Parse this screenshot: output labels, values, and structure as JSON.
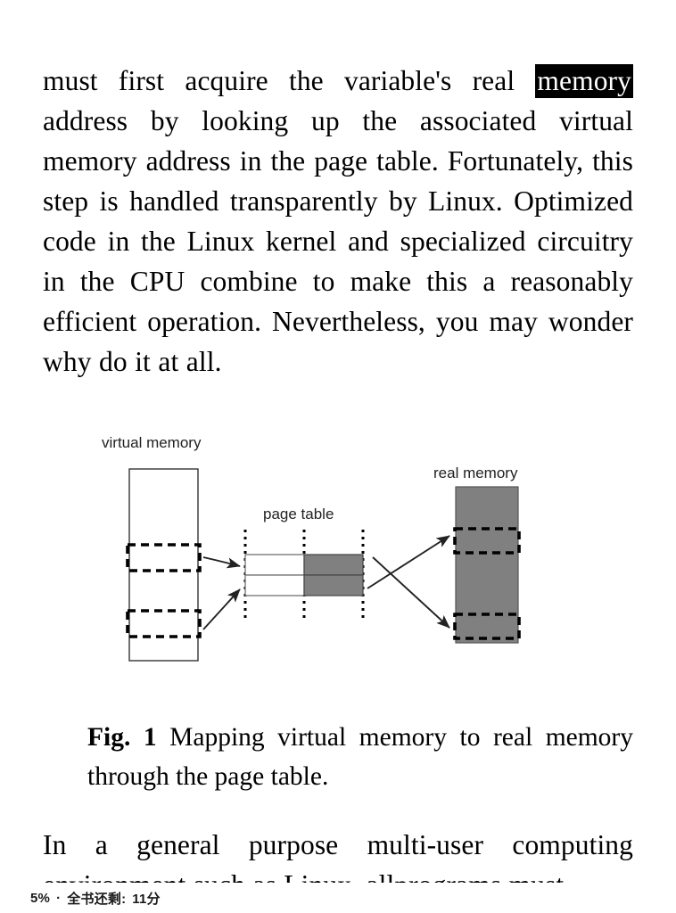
{
  "document": {
    "paragraph_top": {
      "before_highlight": "must first acquire the variable's real ",
      "highlight": "memory",
      "after_highlight": " address by looking up the associated virtual memory address in the page table. Fortunately, this step is handled transparently by Linux. Optimized code in the Linux kernel and specialized circuitry in the CPU combine to make this a reasonably efficient operation. Nevertheless, you may wonder why do it at all."
    },
    "paragraph_bottom": "In a general purpose multi-user computing environment such as Linux, allprograms must",
    "figure": {
      "caption_lead": "Fig. 1",
      "caption_text": " Mapping virtual memory to real memory through the page table.",
      "labels": {
        "virtual_memory": "virtual memory",
        "page_table": "page table",
        "real_memory": "real memory"
      },
      "colors": {
        "fill_gray": "#808080",
        "stroke": "#000000",
        "white": "#ffffff"
      }
    }
  },
  "status_bar": {
    "progress_percent": "5%",
    "separator": "·",
    "remaining_label": "全书还剩:",
    "remaining_value": "11分"
  }
}
